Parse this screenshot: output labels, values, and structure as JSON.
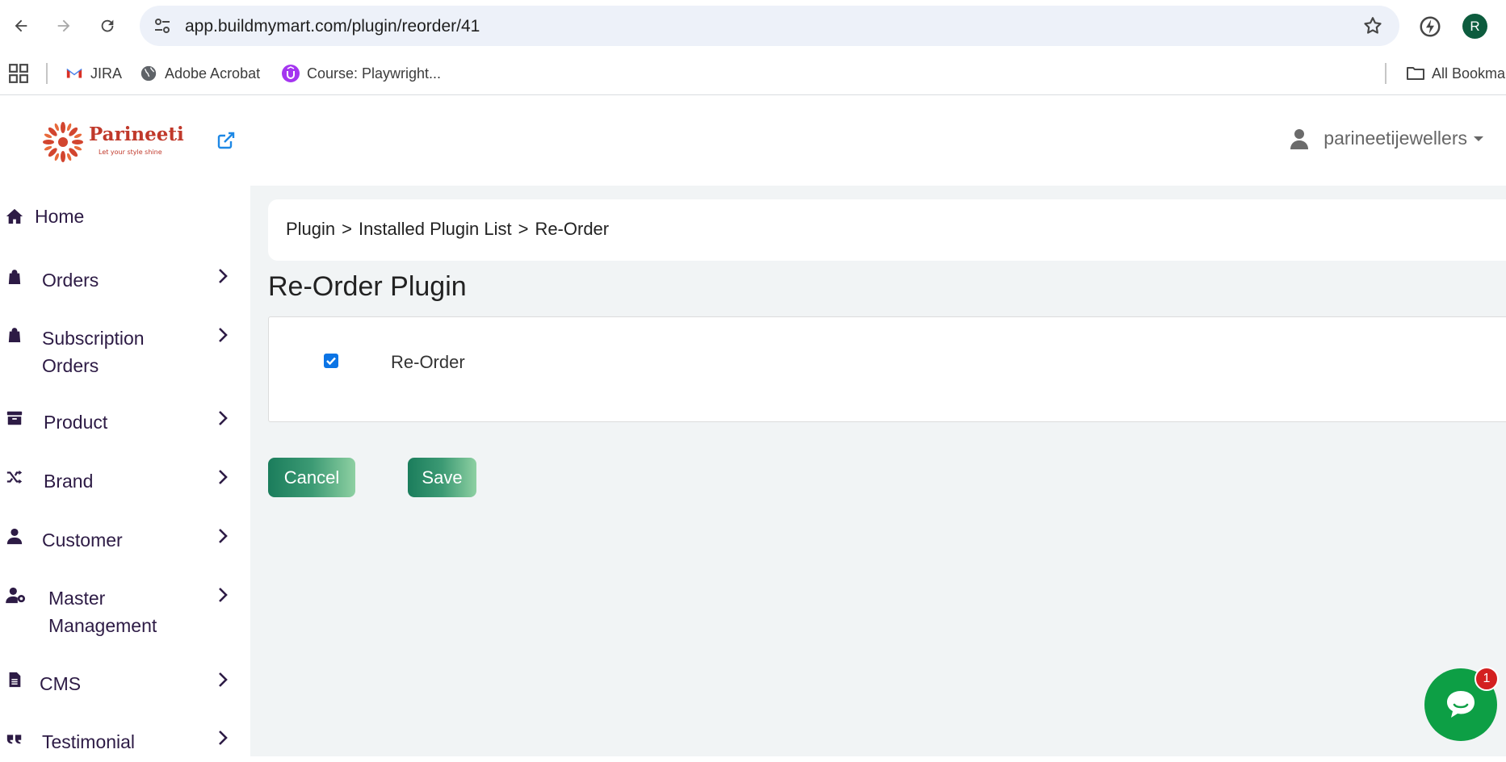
{
  "browser": {
    "url": "app.buildmymart.com/plugin/reorder/41",
    "profile_initial": "R",
    "bookmarks": [
      {
        "label": "JIRA",
        "icon": "gmail-icon"
      },
      {
        "label": "Adobe Acrobat",
        "icon": "globe-icon"
      },
      {
        "label": "Course: Playwright...",
        "icon": "udemy-icon"
      }
    ],
    "all_bookmarks_label": "All Bookma"
  },
  "header": {
    "brand_name": "Parineeti",
    "brand_tagline": "Let your style shine",
    "username": "parineetijewellers"
  },
  "sidebar": {
    "items": [
      {
        "label": "Home",
        "icon": "home-icon"
      },
      {
        "label": "Orders",
        "icon": "shopping-bag-icon"
      },
      {
        "label": "Subscription",
        "label2": "Orders",
        "icon": "shopping-bag-icon"
      },
      {
        "label": "Product",
        "icon": "archive-box-icon"
      },
      {
        "label": "Brand",
        "icon": "shuffle-icon"
      },
      {
        "label": "Customer",
        "icon": "user-icon"
      },
      {
        "label": "Master",
        "label2": "Management",
        "icon": "user-gear-icon"
      },
      {
        "label": "CMS",
        "icon": "document-icon"
      },
      {
        "label": "Testimonial",
        "icon": "quote-icon"
      }
    ]
  },
  "breadcrumb": {
    "items": [
      "Plugin",
      "Installed Plugin List",
      "Re-Order"
    ],
    "separator": ">"
  },
  "page": {
    "title": "Re-Order Plugin",
    "plugin_label": "Re-Order",
    "plugin_checked": true,
    "cancel_label": "Cancel",
    "save_label": "Save"
  },
  "chat": {
    "badge_count": "1"
  },
  "colors": {
    "sidebar_text": "#2d1b45",
    "button_gradient_start": "#1b7d5c",
    "button_gradient_end": "#8ed0a2",
    "main_bg": "#f1f4f5",
    "chat_green": "#0d9f45",
    "badge_red": "#d32020"
  }
}
